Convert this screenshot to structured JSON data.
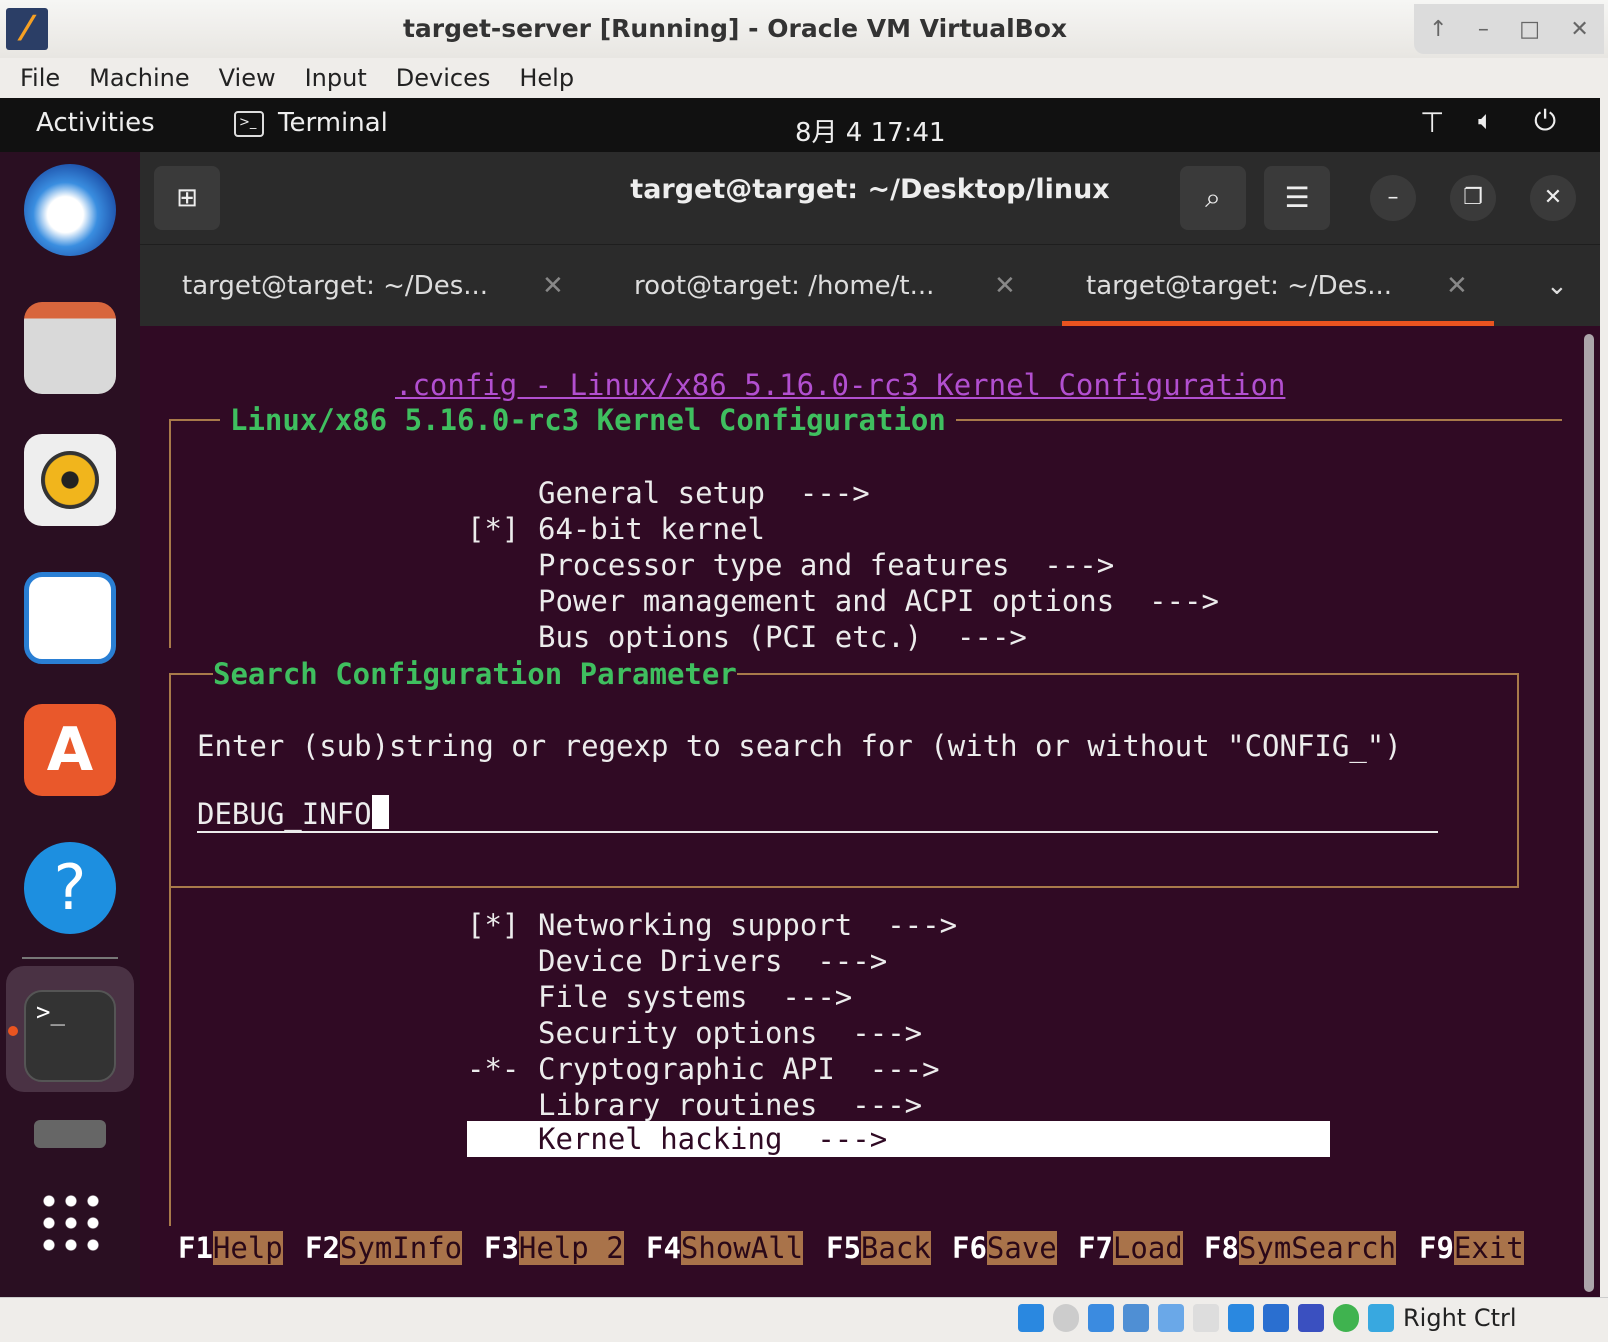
{
  "window": {
    "title": "target-server [Running] - Oracle VM VirtualBox",
    "controls": [
      "↑",
      "–",
      "□",
      "✕"
    ]
  },
  "menu": [
    "File",
    "Machine",
    "View",
    "Input",
    "Devices",
    "Help"
  ],
  "topbar": {
    "activities": "Activities",
    "app": "Terminal",
    "clock": "8月 4  17:41"
  },
  "terminal": {
    "title": "target@target: ~/Desktop/linux",
    "tabs": [
      {
        "label": "target@target: ~/Des...",
        "active": false
      },
      {
        "label": "root@target: /home/t...",
        "active": false
      },
      {
        "label": "target@target: ~/Des...",
        "active": true
      }
    ]
  },
  "kconfig": {
    "file_title": ".config - Linux/x86 5.16.0-rc3 Kernel Configuration",
    "box_title": "Linux/x86 5.16.0-rc3 Kernel Configuration",
    "items_top": [
      {
        "mark": "",
        "label": "General setup  --->"
      },
      {
        "mark": "[*]",
        "label": "64-bit kernel"
      },
      {
        "mark": "",
        "label": "Processor type and features  --->"
      },
      {
        "mark": "",
        "label": "Power management and ACPI options  --->"
      },
      {
        "mark": "",
        "label": "Bus options (PCI etc.)  --->"
      }
    ],
    "dialog": {
      "title": "Search Configuration Parameter",
      "prompt": "Enter (sub)string or regexp to search for (with or without \"CONFIG_\")",
      "value": "DEBUG_INFO"
    },
    "items_bottom": [
      {
        "mark": "[*]",
        "label": "Networking support  --->"
      },
      {
        "mark": "",
        "label": "Device Drivers  --->"
      },
      {
        "mark": "",
        "label": "File systems  --->"
      },
      {
        "mark": "",
        "label": "Security options  --->"
      },
      {
        "mark": "-*-",
        "label": "Cryptographic API  --->"
      },
      {
        "mark": "",
        "label": "Library routines  --->"
      },
      {
        "mark": "",
        "label": "Kernel hacking  --->"
      }
    ],
    "fkeys": [
      {
        "key": "F1",
        "label": "Help"
      },
      {
        "key": "F2",
        "label": "SymInfo"
      },
      {
        "key": "F3",
        "label": "Help 2"
      },
      {
        "key": "F4",
        "label": "ShowAll"
      },
      {
        "key": "F5",
        "label": "Back"
      },
      {
        "key": "F6",
        "label": "Save"
      },
      {
        "key": "F7",
        "label": "Load"
      },
      {
        "key": "F8",
        "label": "SymSearch"
      },
      {
        "key": "F9",
        "label": "Exit"
      }
    ]
  },
  "statusbar": {
    "hostkey": "Right Ctrl"
  }
}
